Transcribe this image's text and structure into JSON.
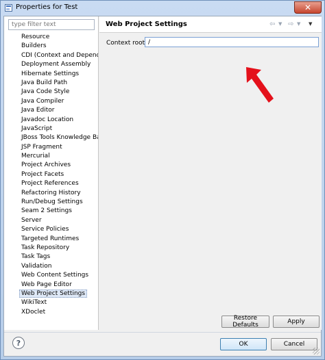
{
  "window": {
    "title": "Properties for Test",
    "close_glyph": "✕"
  },
  "filter": {
    "placeholder": "type filter text"
  },
  "tree": {
    "items": [
      "Resource",
      "Builders",
      "CDI (Context and Depender",
      "Deployment Assembly",
      "Hibernate Settings",
      "Java Build Path",
      "Java Code Style",
      "Java Compiler",
      "Java Editor",
      "Javadoc Location",
      "JavaScript",
      "JBoss Tools Knowledge Bas",
      "JSP Fragment",
      "Mercurial",
      "Project Archives",
      "Project Facets",
      "Project References",
      "Refactoring History",
      "Run/Debug Settings",
      "Seam 2 Settings",
      "Server",
      "Service Policies",
      "Targeted Runtimes",
      "Task Repository",
      "Task Tags",
      "Validation",
      "Web Content Settings",
      "Web Page Editor",
      "Web Project Settings",
      "WikiText",
      "XDoclet"
    ],
    "selected": "Web Project Settings"
  },
  "page": {
    "title": "Web Project Settings",
    "context_root_label": "Context root:",
    "context_root_value": "/",
    "restore_defaults_label": "Restore Defaults",
    "apply_label": "Apply"
  },
  "footer": {
    "help_glyph": "?",
    "ok_label": "OK",
    "cancel_label": "Cancel"
  },
  "colors": {
    "annotation_arrow": "#e4111b",
    "selection": "#dfe9f7",
    "titlebar": "#c9dbf2",
    "close_button": "#c7452e"
  },
  "icons": [
    "app-icon",
    "back-arrow-icon",
    "forward-arrow-icon",
    "view-menu-icon",
    "help-icon",
    "red-arrow-annotation"
  ]
}
